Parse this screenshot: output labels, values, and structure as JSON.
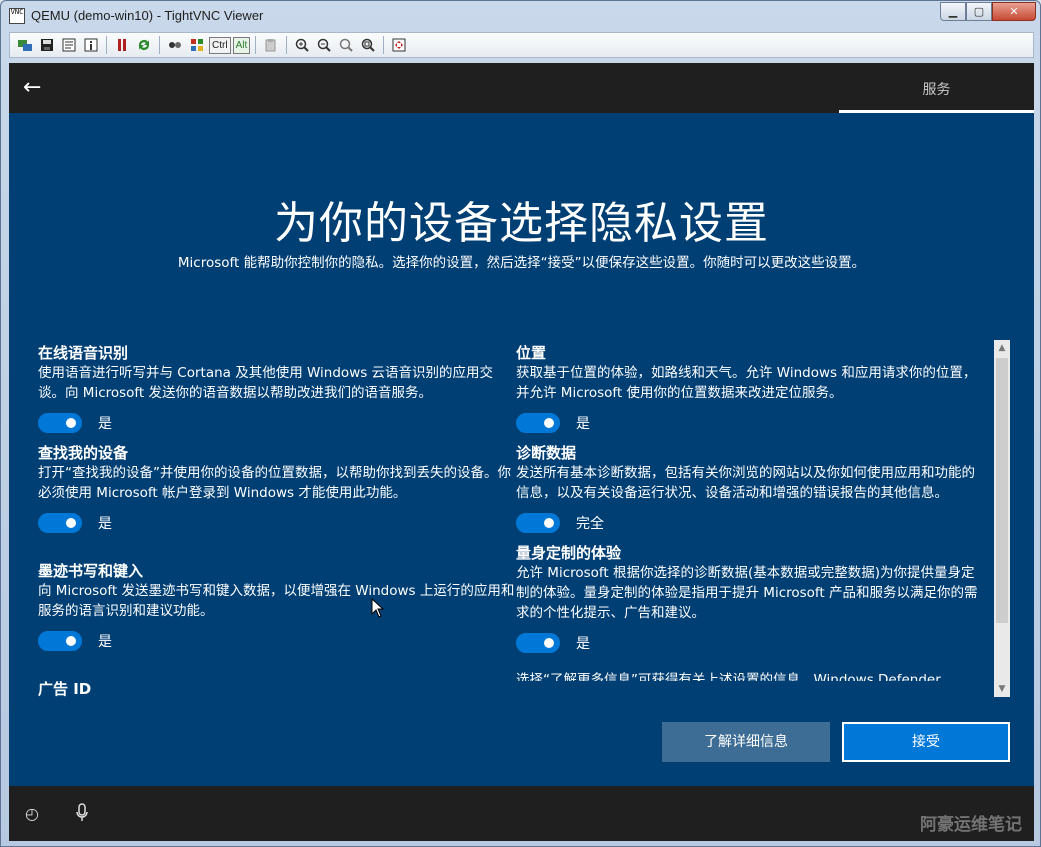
{
  "window": {
    "title": "QEMU (demo-win10) - TightVNC Viewer",
    "icon_text": "VNC",
    "minimize": "▁",
    "maximize": "▢",
    "close": "✕"
  },
  "toolbar": {
    "ctrl_label": "Ctrl",
    "alt_label": "Alt"
  },
  "oobe": {
    "back_icon": "←",
    "tab_label": "服务",
    "title": "为你的设备选择隐私设置",
    "subtitle": "Microsoft 能帮助你控制你的隐私。选择你的设置，然后选择“接受”以便保存这些设置。你随时可以更改这些设置。",
    "left_settings": [
      {
        "title": "在线语音识别",
        "desc": "使用语音进行听写并与 Cortana 及其他使用 Windows 云语音识别的应用交谈。向 Microsoft 发送你的语音数据以帮助改进我们的语音服务。",
        "state": "是"
      },
      {
        "title": "查找我的设备",
        "desc": "打开“查找我的设备”并使用你的设备的位置数据，以帮助你找到丢失的设备。你必须使用 Microsoft 帐户登录到 Windows 才能使用此功能。",
        "state": "是"
      },
      {
        "title": "墨迹书写和键入",
        "desc": "向 Microsoft 发送墨迹书写和键入数据，以便增强在 Windows 上运行的应用和服务的语言识别和建议功能。",
        "state": "是"
      },
      {
        "title": "广告 ID"
      }
    ],
    "right_settings": [
      {
        "title": "位置",
        "desc": "获取基于位置的体验，如路线和天气。允许 Windows 和应用请求你的位置，并允许 Microsoft 使用你的位置数据来改进定位服务。",
        "state": "是"
      },
      {
        "title": "诊断数据",
        "desc": "发送所有基本诊断数据，包括有关你浏览的网站以及你如何使用应用和功能的信息，以及有关设备运行状况、设备活动和增强的错误报告的其他信息。",
        "state": "完全"
      },
      {
        "title": "量身定制的体验",
        "desc": "允许 Microsoft 根据你选择的诊断数据(基本数据或完整数据)为你提供量身定制的体验。量身定制的体验是指用于提升 Microsoft 产品和服务以满足你的需求的个性化提示、广告和建议。",
        "state": "是"
      }
    ],
    "footer_text": "选择“了解更多信息”可获得有关上述设置的信息，Windows Defender",
    "learn_more": "了解详细信息",
    "accept": "接受",
    "ease_icon": "◴",
    "watermark": "阿豪运维笔记"
  },
  "colors": {
    "background": "#003f74",
    "bar": "#1f1f1f",
    "accent": "#0078d7",
    "secondary_button": "#3d6d94"
  }
}
